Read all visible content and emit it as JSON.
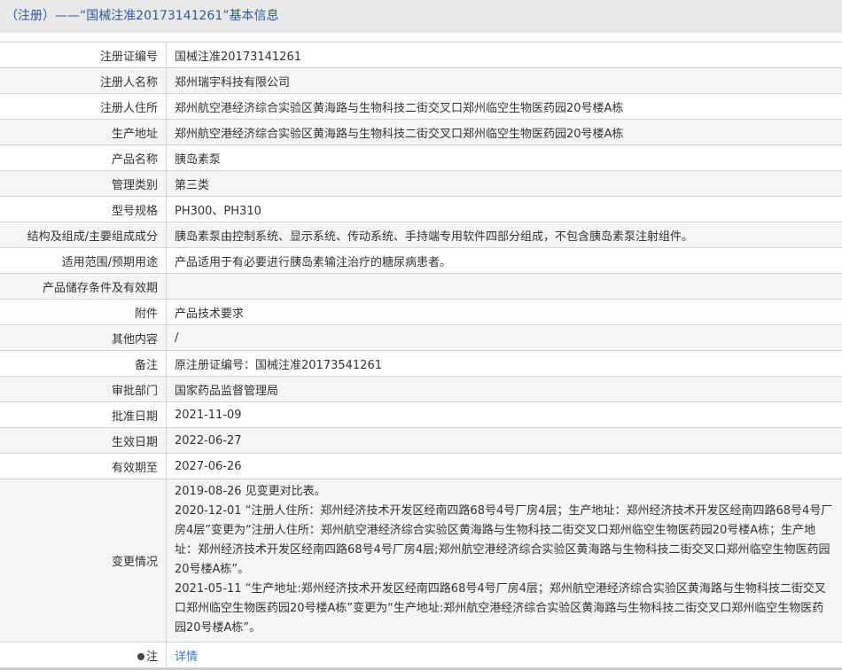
{
  "header": {
    "title": "（注册）——“国械注准20173141261”基本信息"
  },
  "rows": [
    {
      "label": "注册证编号",
      "value": "国械注准20173141261"
    },
    {
      "label": "注册人名称",
      "value": "郑州瑞宇科技有限公司"
    },
    {
      "label": "注册人住所",
      "value": "郑州航空港经济综合实验区黄海路与生物科技二街交叉口郑州临空生物医药园20号楼A栋"
    },
    {
      "label": "生产地址",
      "value": "郑州航空港经济综合实验区黄海路与生物科技二街交叉口郑州临空生物医药园20号楼A栋"
    },
    {
      "label": "产品名称",
      "value": "胰岛素泵"
    },
    {
      "label": "管理类别",
      "value": "第三类"
    },
    {
      "label": "型号规格",
      "value": "PH300、PH310"
    },
    {
      "label": "结构及组成/主要组成成分",
      "value": "胰岛素泵由控制系统、显示系统、传动系统、手持端专用软件四部分组成，不包含胰岛素泵注射组件。"
    },
    {
      "label": "适用范围/预期用途",
      "value": "产品适用于有必要进行胰岛素输注治疗的糖尿病患者。"
    },
    {
      "label": "产品储存条件及有效期",
      "value": ""
    },
    {
      "label": "附件",
      "value": "产品技术要求"
    },
    {
      "label": "其他内容",
      "value": "/"
    },
    {
      "label": "备注",
      "value": "原注册证编号：国械注准20173541261"
    },
    {
      "label": "审批部门",
      "value": "国家药品监督管理局"
    },
    {
      "label": "批准日期",
      "value": "2021-11-09"
    },
    {
      "label": "生效日期",
      "value": "2022-06-27"
    },
    {
      "label": "有效期至",
      "value": "2027-06-26"
    }
  ],
  "changes": {
    "label": "变更情况",
    "entries": [
      "2019-08-26 见变更对比表。",
      "2020-12-01 “注册人住所：郑州经济技术开发区经南四路68号4号厂房4层；生产地址：郑州经济技术开发区经南四路68号4号厂房4层”变更为“注册人住所：郑州航空港经济综合实验区黄海路与生物科技二街交叉口郑州临空生物医药园20号楼A栋；生产地址：郑州经济技术开发区经南四路68号4号厂房4层;郑州航空港经济综合实验区黄海路与生物科技二街交叉口郑州临空生物医药园20号楼A栋”。",
      "2021-05-11 “生产地址:郑州经济技术开发区经南四路68号4号厂房4层；郑州航空港经济综合实验区黄海路与生物科技二街交叉口郑州临空生物医药园20号楼A栋”变更为“生产地址:郑州航空港经济综合实验区黄海路与生物科技二街交叉口郑州临空生物医药园20号楼A栋”。"
    ]
  },
  "note": {
    "label": "注",
    "link": "详情"
  }
}
